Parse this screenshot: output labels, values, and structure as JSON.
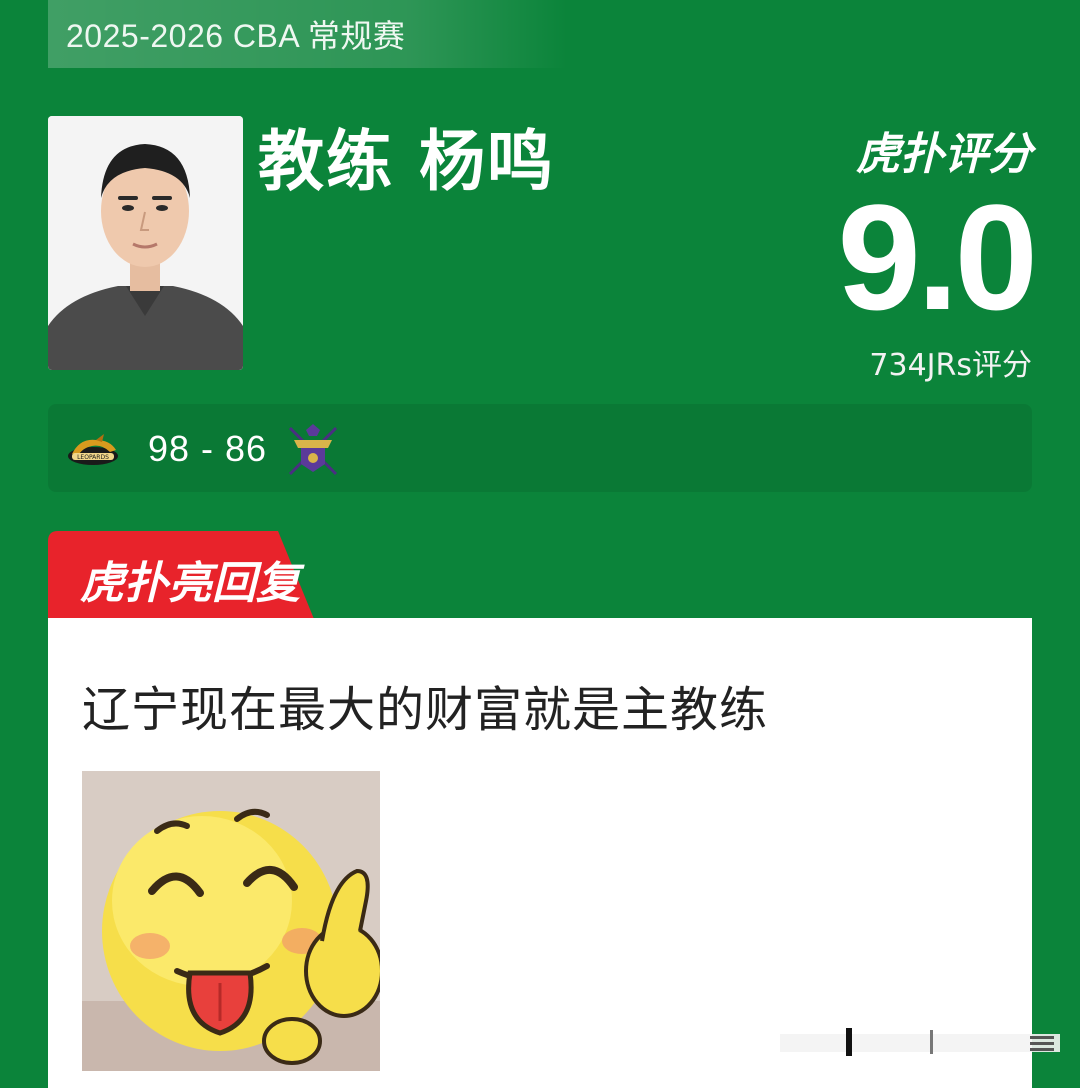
{
  "season": {
    "label": "2025-2026 CBA 常规赛"
  },
  "coach": {
    "title_name": "教练 杨鸣"
  },
  "rating": {
    "brand": "虎扑评分",
    "score": "9.0",
    "count_label": "734JRs评分"
  },
  "match": {
    "score": "98 - 86",
    "home_team_icon": "leopards-logo-icon",
    "away_team_icon": "royal-fighters-logo-icon"
  },
  "highlight": {
    "tag": "虎扑亮回复",
    "reply_text": "辽宁现在最大的财富就是主教练",
    "image_icon": "smiley-thumbs-up-emoji"
  },
  "colors": {
    "background": "#0b843a",
    "tag_red": "#e8232b",
    "card": "#ffffff"
  }
}
